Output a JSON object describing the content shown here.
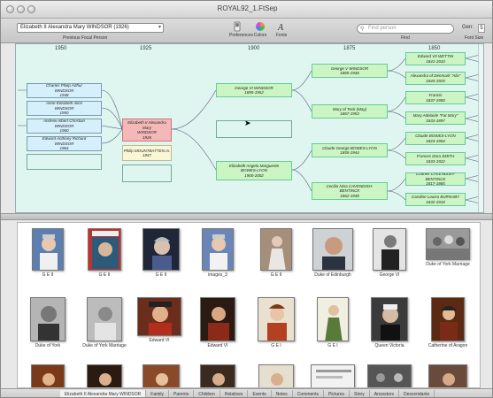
{
  "window": {
    "title": "ROYAL92_1.FtSep"
  },
  "toolbar": {
    "person_select_value": "Elizabeth II Alexandra Mary WINDSOR (1926)",
    "person_caption": "Previous Focal Person",
    "buttons": [
      {
        "label": "Preferences",
        "icon": "switch-icon"
      },
      {
        "label": "Colors",
        "icon": "color-wheel-icon"
      },
      {
        "label": "Fonts",
        "icon": "font-icon"
      }
    ],
    "find_placeholder": "Find person",
    "find_caption": "Find",
    "gens_label": "Gen:",
    "gens_value": "5",
    "font_size_caption": "Font Size"
  },
  "tree": {
    "year_headers": [
      "1950",
      "1925",
      "1900",
      "1875",
      "1850"
    ],
    "children": [
      {
        "name": "Charles Philip Arthur",
        "surname": "WINDSOR",
        "dates": "1948"
      },
      {
        "name": "Anne Elizabeth Alice",
        "surname": "WINDSOR",
        "dates": "1950"
      },
      {
        "name": "Andrew Albert Christian",
        "surname": "WINDSOR",
        "dates": "1960"
      },
      {
        "name": "Edward Anthony Richard",
        "surname": "WINDSOR",
        "dates": "1964"
      }
    ],
    "focal": {
      "name": "Elizabeth II Alexandra Mary",
      "surname": "WINDSOR",
      "dates": "1926"
    },
    "spouse": {
      "label": "Philip MOUNTBATTEN m.",
      "dates": "1947"
    },
    "parents": [
      {
        "name": "George VI WINDSOR",
        "dates": "1895-1952"
      },
      {
        "name": "Elizabeth Angela Marguerite",
        "surname": "BOWES-LYON",
        "dates": "1900-2002"
      }
    ],
    "grandparents": [
      {
        "name": "George V WINDSOR",
        "dates": "1865-1936"
      },
      {
        "name": "Mary of Teck (May)",
        "dates": "1867-1953"
      },
      {
        "name": "Claude George BOWES-LYON",
        "dates": "1855-1944"
      },
      {
        "name": "Cecilia Nina CAVENDISH-",
        "surname": "BENTINCK",
        "dates": "1862-1938"
      }
    ],
    "great_grandparents": [
      {
        "name": "Edward VII WETTIN",
        "dates": "1841-1910"
      },
      {
        "name": "Alexandra of Denmark \"Alix\"",
        "dates": "1844-1925"
      },
      {
        "name": "Francis",
        "dates": "1837-1900"
      },
      {
        "name": "Mary Adelaide \"Fat Mary\"",
        "dates": "1833-1897"
      },
      {
        "name": "Claude BOWES-LYON",
        "dates": "1824-1904"
      },
      {
        "name": "Frances Dora SMITH",
        "dates": "1833-1922"
      },
      {
        "name": "Charles CAVENDISH-BENTINCK",
        "dates": "1817-1865"
      },
      {
        "name": "Caroline Louisa BURNABY",
        "dates": "1832-1918"
      }
    ]
  },
  "media": {
    "rows": [
      [
        "G E II",
        "G E II",
        "G E II",
        "images_3",
        "G E II",
        "Duke of Edinburgh",
        "George VI",
        "Duke of York Marriage"
      ],
      [
        "Duke of York",
        "Duke of York Marriage",
        "Edward VI",
        "Edward VI",
        "G E I",
        "G E I",
        "Queen Victoria",
        "Catherine of Aragon"
      ],
      [
        "",
        "",
        "",
        "",
        "",
        "",
        "",
        ""
      ]
    ]
  },
  "tabs": [
    "Elizabeth II Alexandra Mary WINDSOR",
    "Family",
    "Parents",
    "Children",
    "Relatives",
    "Events",
    "Notes",
    "Comments",
    "Pictures",
    "Story",
    "Ancestors",
    "Descendants"
  ]
}
